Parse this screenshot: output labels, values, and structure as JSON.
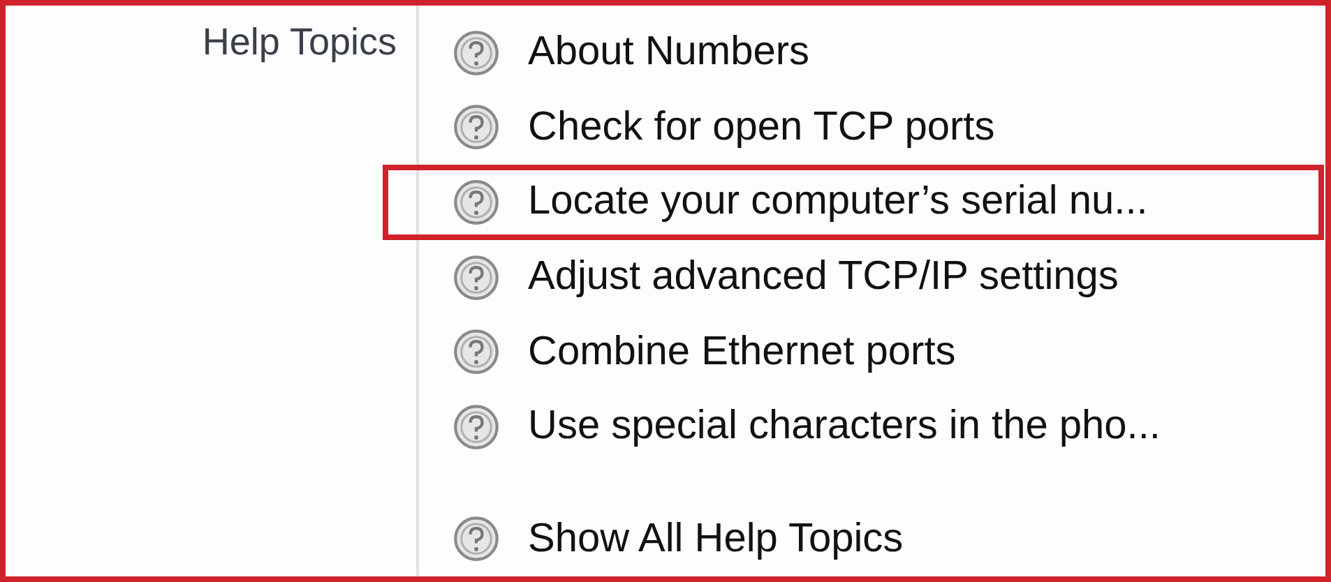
{
  "sidebar": {
    "label": "Help Topics"
  },
  "topics": [
    {
      "label": "About Numbers",
      "highlighted": false
    },
    {
      "label": "Check for open TCP ports",
      "highlighted": false
    },
    {
      "label": "Locate your computer’s serial nu...",
      "highlighted": true
    },
    {
      "label": "Adjust advanced TCP/IP settings",
      "highlighted": false
    },
    {
      "label": "Combine Ethernet ports",
      "highlighted": false
    },
    {
      "label": "Use special characters in the pho...",
      "highlighted": false
    }
  ],
  "footer_item": {
    "label": "Show All Help Topics"
  }
}
